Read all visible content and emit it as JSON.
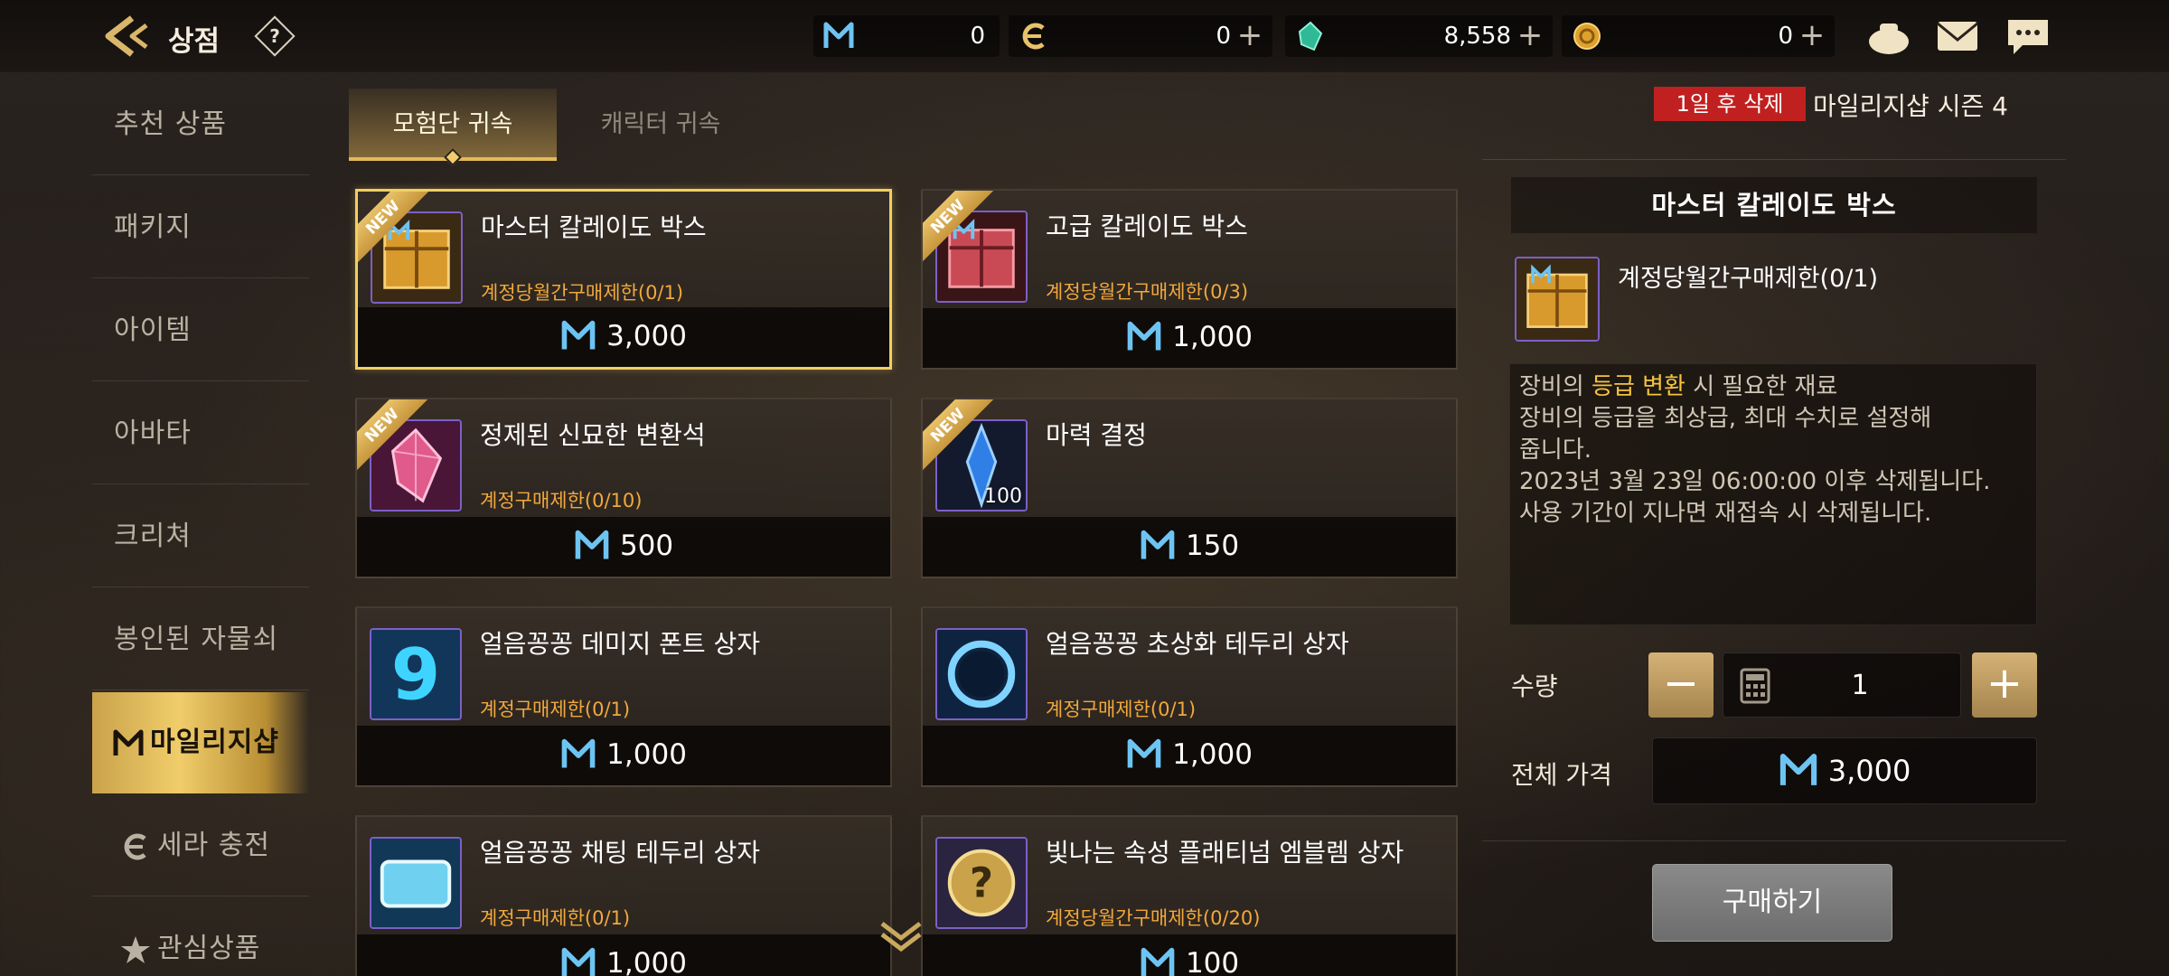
{
  "header": {
    "title": "상점",
    "help_label": "?",
    "currencies": [
      {
        "name": "mileage",
        "value": "0",
        "color": "#5fb4e6"
      },
      {
        "name": "cera",
        "value": "0",
        "color": "#e8c26a"
      },
      {
        "name": "gem",
        "value": "8,558",
        "color": "#37c7a5"
      },
      {
        "name": "gold",
        "value": "0",
        "color": "#e3a230"
      }
    ],
    "plus_label": "+"
  },
  "sidebar": {
    "items": [
      {
        "label": "추천 상품"
      },
      {
        "label": "패키지"
      },
      {
        "label": "아이템"
      },
      {
        "label": "아바타"
      },
      {
        "label": "크리쳐"
      },
      {
        "label": "봉인된 자물쇠"
      },
      {
        "label": "마일리지샵",
        "active": true
      },
      {
        "label": "세라 충전"
      },
      {
        "label": "관심상품"
      }
    ]
  },
  "tabs": [
    {
      "label": "모험단 귀속",
      "active": true
    },
    {
      "label": "캐릭터 귀속",
      "active": false
    }
  ],
  "new_label": "NEW",
  "products": [
    {
      "name": "마스터 칼레이도 박스",
      "limit": "계정당월간구매제한(0/1)",
      "price": "3,000",
      "new": true,
      "selected": true
    },
    {
      "name": "고급 칼레이도 박스",
      "limit": "계정당월간구매제한(0/3)",
      "price": "1,000",
      "new": true
    },
    {
      "name": "정제된 신묘한 변환석",
      "limit": "계정구매제한(0/10)",
      "price": "500",
      "new": true
    },
    {
      "name": "마력 결정",
      "limit": "",
      "price": "150",
      "new": true,
      "qty_badge": "100"
    },
    {
      "name": "얼음꽁꽁 데미지 폰트 상자",
      "limit": "계정구매제한(0/1)",
      "price": "1,000"
    },
    {
      "name": "얼음꽁꽁 초상화 테두리 상자",
      "limit": "계정구매제한(0/1)",
      "price": "1,000"
    },
    {
      "name": "얼음꽁꽁 채팅 테두리 상자",
      "limit": "계정구매제한(0/1)",
      "price": "1,000"
    },
    {
      "name": "빛나는 속성 플래티넘 엠블렘 상자",
      "limit": "계정당월간구매제한(0/20)",
      "price": "100"
    }
  ],
  "detail": {
    "expiry_badge": "1일 후 삭제",
    "season_label": "마일리지샵 시즌 4",
    "title": "마스터 칼레이도 박스",
    "limit": "계정당월간구매제한(0/1)",
    "desc": {
      "line1_prefix": "장비의 ",
      "line1_highlight": "등급 변환",
      "line1_suffix": " 시 필요한 재료",
      "line2": "장비의 등급을 최상급, 최대 수치로 설정해",
      "line3": "줍니다.",
      "line4": "2023년 3월 23일 06:00:00 이후 삭제됩니다.",
      "line5": "사용 기간이 지나면 재접속 시 삭제됩니다."
    },
    "quantity_label": "수량",
    "minus_label": "−",
    "plus_label": "+",
    "quantity_value": "1",
    "total_label": "전체 가격",
    "total_value": "3,000",
    "buy_label": "구매하기"
  }
}
